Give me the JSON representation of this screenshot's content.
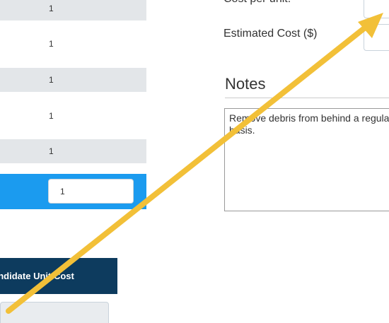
{
  "quantity_table": {
    "rows": [
      {
        "value": "1",
        "style": "shaded"
      },
      {
        "value": "1",
        "style": "plain"
      },
      {
        "value": "1",
        "style": "shaded"
      },
      {
        "value": "1",
        "style": "plain"
      },
      {
        "value": "1",
        "style": "shaded"
      }
    ],
    "selected_row": {
      "value": "1"
    }
  },
  "candidate": {
    "header": "andidate Unit Cost"
  },
  "form": {
    "cost_per_unit_label": "Cost per unit:",
    "estimated_cost_label": "Estimated Cost ($)"
  },
  "notes": {
    "heading": "Notes",
    "text": "Remove debris from behind a regular basis."
  },
  "colors": {
    "selected_row": "#1b9bef",
    "header_bg": "#0d3b5e",
    "arrow": "#f2c038"
  },
  "annotation": {
    "icon": "arrow-icon"
  }
}
